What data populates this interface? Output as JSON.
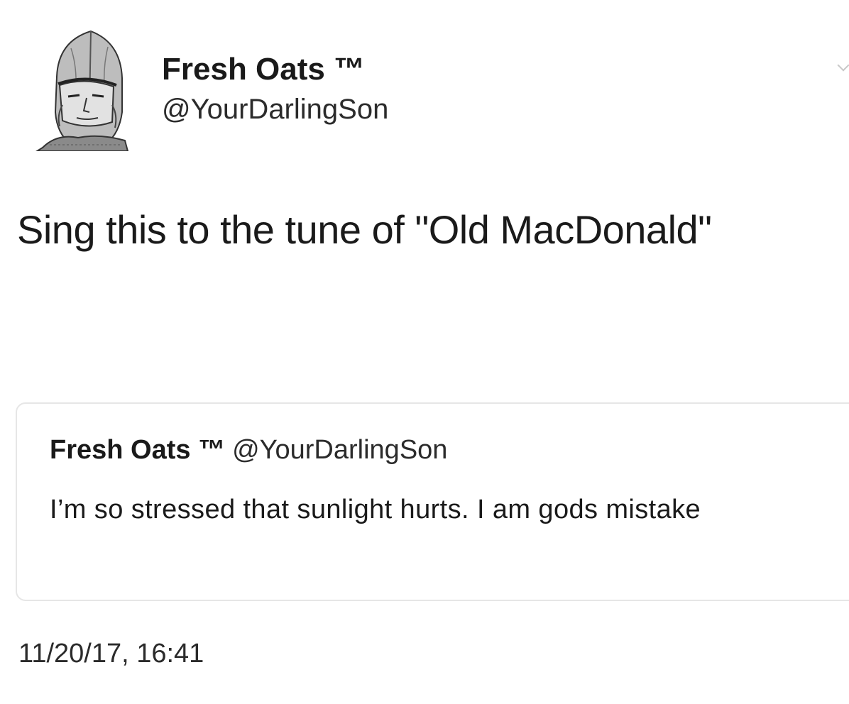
{
  "tweet": {
    "author": {
      "display_name": "Fresh Oats ™",
      "handle": "@YourDarlingSon",
      "avatar_icon": "knight-helmet-avatar"
    },
    "text": "Sing this to the tune of \"Old MacDonald\"",
    "quoted_tweet": {
      "display_name": "Fresh Oats ™",
      "handle": "@YourDarlingSon",
      "text": "I’m so stressed that sunlight hurts. I am gods mistake"
    },
    "timestamp": "11/20/17, 16:41"
  },
  "colors": {
    "background": "#ffffff",
    "text": "#1a1a1a",
    "quote_border": "#e6e6e6"
  }
}
